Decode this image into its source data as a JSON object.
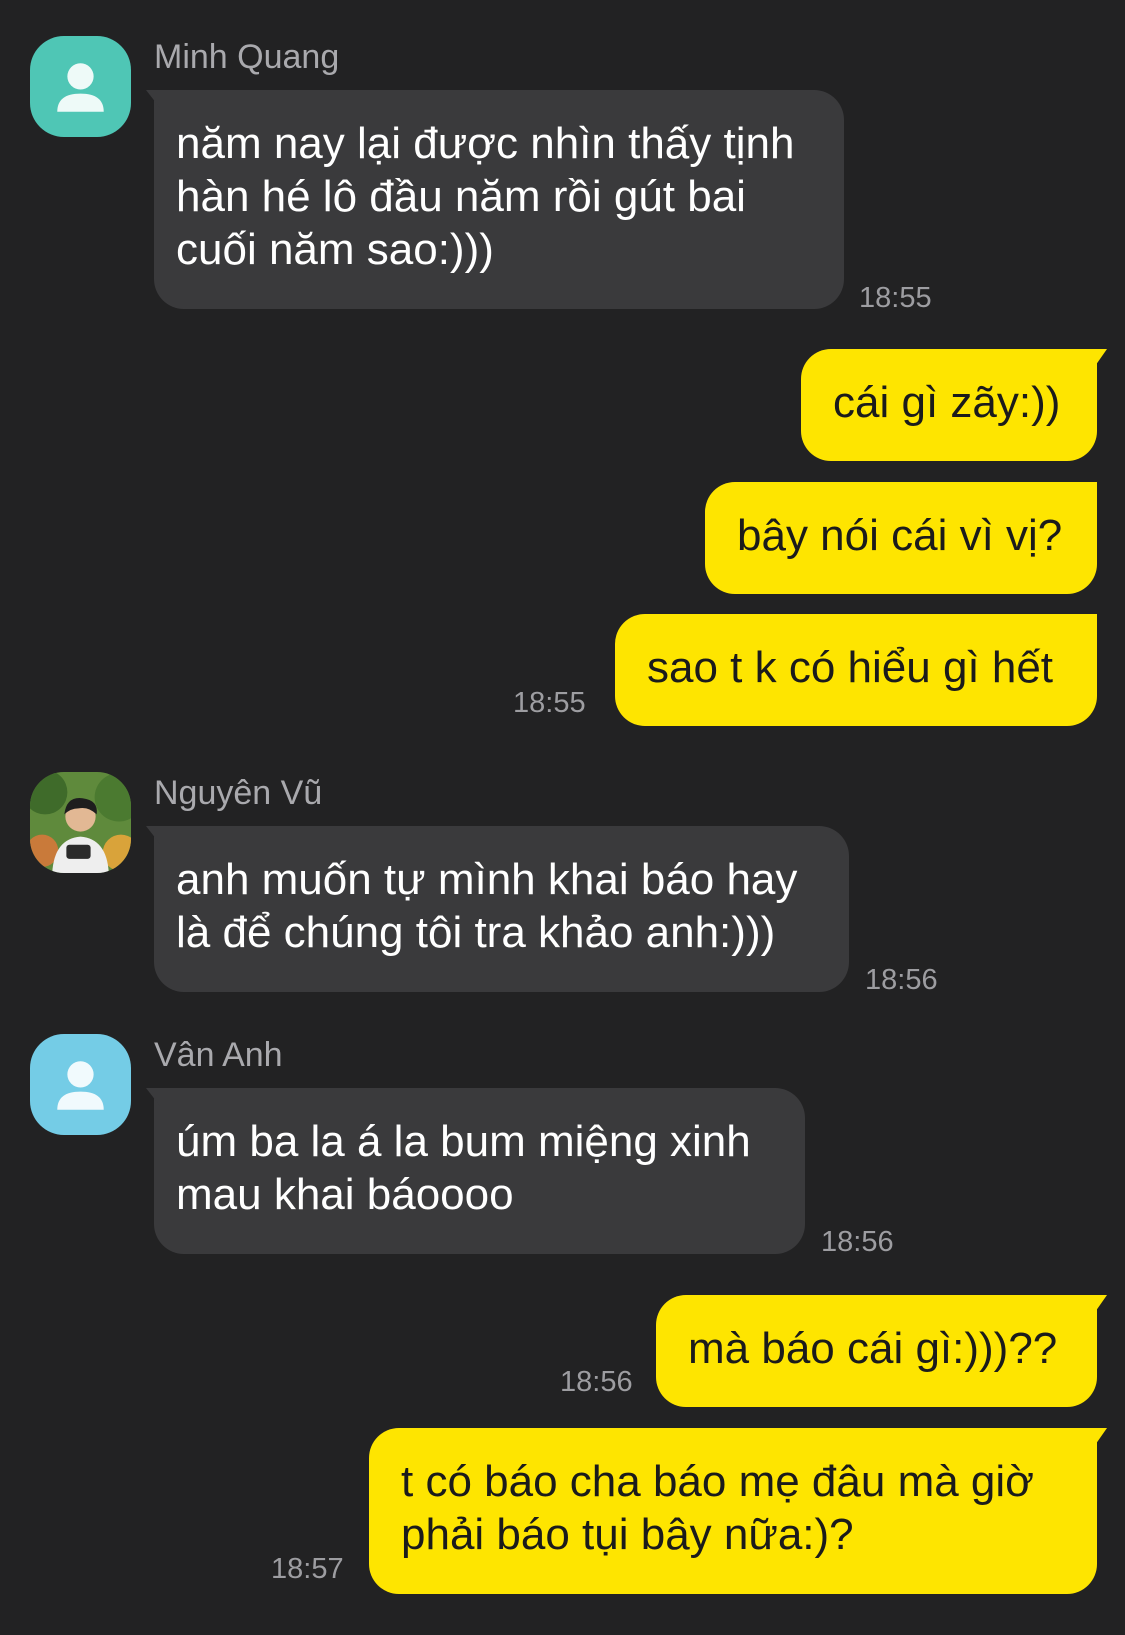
{
  "messages": [
    {
      "sender": "Minh Quang",
      "avatar": "default-person-avatar",
      "avatar_color": "#4fc6b5",
      "lines": [
        "năm nay lại được nhìn thấy tịnh",
        "hàn hé lô đầu năm rồi gút bai",
        "cuối năm sao:)))"
      ],
      "time": "18:55"
    },
    {
      "lines": [
        "cái gì zãy:))"
      ]
    },
    {
      "lines": [
        "bây nói cái vì vị?"
      ]
    },
    {
      "lines": [
        "sao t k có hiểu gì hết"
      ],
      "time": "18:55"
    },
    {
      "sender": "Nguyên Vũ",
      "avatar": "photo-avatar",
      "lines": [
        "anh muốn tự mình khai báo hay",
        "là để chúng tôi tra khảo anh:)))"
      ],
      "time": "18:56"
    },
    {
      "sender": "Vân Anh",
      "avatar": "default-person-avatar",
      "avatar_color": "#74cce6",
      "lines": [
        "úm ba la á la bum miệng xinh",
        "mau khai báoooo"
      ],
      "time": "18:56"
    },
    {
      "lines": [
        "mà báo cái gì:)))??"
      ],
      "time": "18:56"
    },
    {
      "lines": [
        "t có báo cha báo mẹ đâu mà giờ",
        "phải báo tụi bây nữa:)?"
      ],
      "time": "18:57"
    }
  ],
  "colors": {
    "background": "#222223",
    "incoming_bubble": "#3a3a3c",
    "outgoing_bubble": "#fee500"
  }
}
